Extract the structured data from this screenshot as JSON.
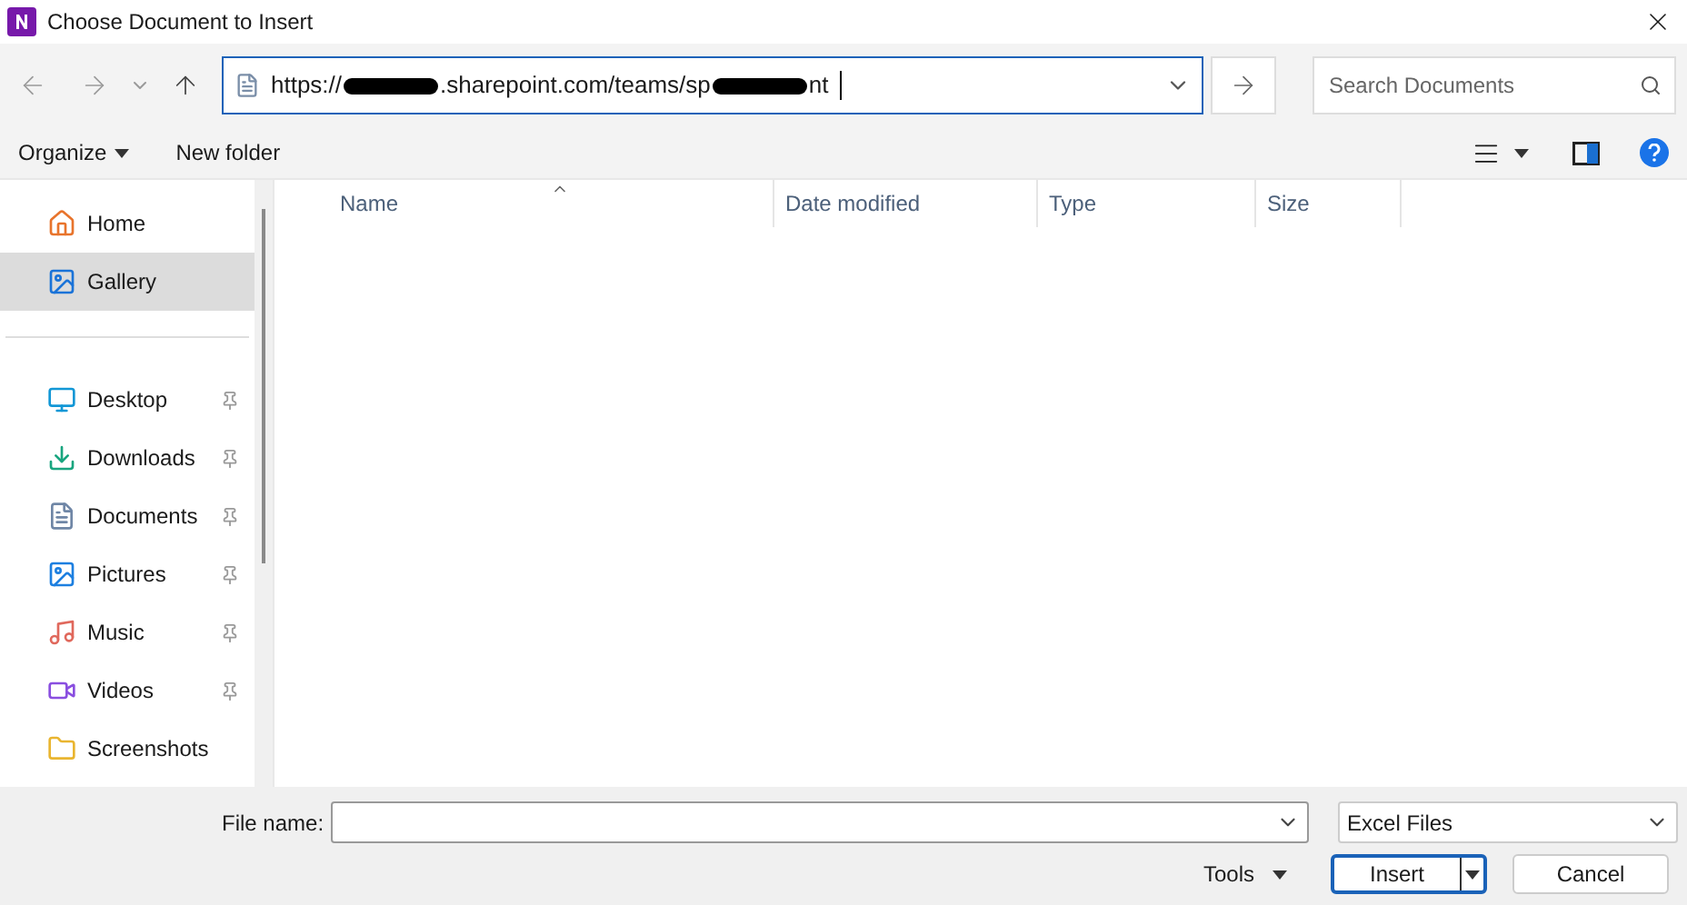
{
  "window": {
    "title": "Choose Document to Insert"
  },
  "address": {
    "parts": [
      {
        "kind": "text",
        "text": "https://"
      },
      {
        "kind": "redacted"
      },
      {
        "kind": "text",
        "text": ".sharepoint.com/teams/sp"
      },
      {
        "kind": "redacted"
      },
      {
        "kind": "text",
        "text": "nt"
      }
    ]
  },
  "search": {
    "placeholder": "Search Documents"
  },
  "command_bar": {
    "organize": "Organize",
    "new_folder": "New folder"
  },
  "sidebar": {
    "groups": [
      {
        "items": [
          {
            "kind": "home",
            "label": "Home",
            "selected": false,
            "pinned": false
          },
          {
            "kind": "gallery",
            "label": "Gallery",
            "selected": true,
            "pinned": false
          }
        ]
      },
      {
        "items": [
          {
            "kind": "desktop",
            "label": "Desktop",
            "selected": false,
            "pinned": true
          },
          {
            "kind": "downloads",
            "label": "Downloads",
            "selected": false,
            "pinned": true
          },
          {
            "kind": "documents",
            "label": "Documents",
            "selected": false,
            "pinned": true
          },
          {
            "kind": "pictures",
            "label": "Pictures",
            "selected": false,
            "pinned": true
          },
          {
            "kind": "music",
            "label": "Music",
            "selected": false,
            "pinned": true
          },
          {
            "kind": "videos",
            "label": "Videos",
            "selected": false,
            "pinned": true
          },
          {
            "kind": "folder",
            "label": "Screenshots",
            "selected": false,
            "pinned": false
          }
        ]
      }
    ]
  },
  "table": {
    "columns": [
      {
        "label": "Name",
        "sorted": true
      },
      {
        "label": "Date modified",
        "sorted": false
      },
      {
        "label": "Type",
        "sorted": false
      },
      {
        "label": "Size",
        "sorted": false
      }
    ]
  },
  "file_name": {
    "label": "File name:"
  },
  "file_type": {
    "value": "Excel Files"
  },
  "buttons": {
    "tools": "Tools",
    "insert": "Insert",
    "cancel": "Cancel"
  }
}
